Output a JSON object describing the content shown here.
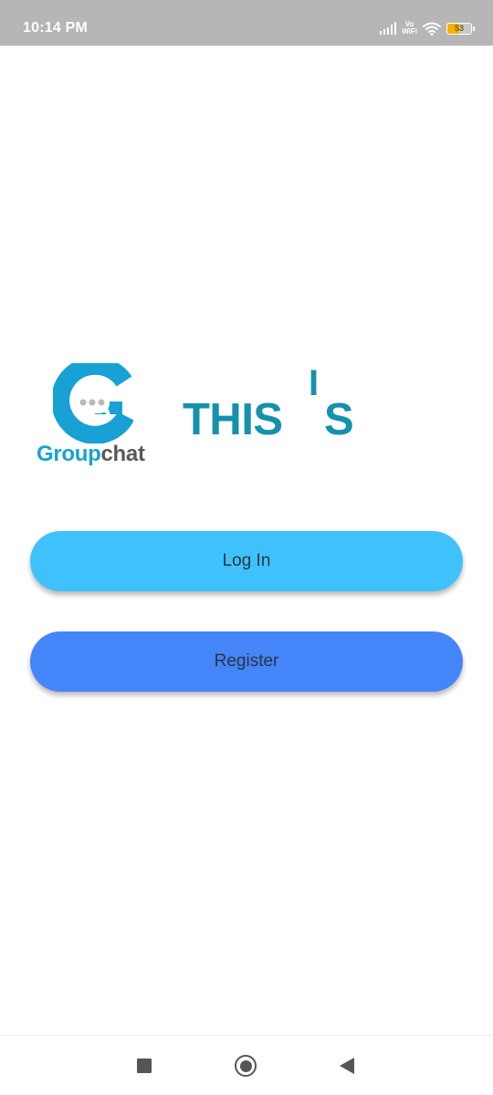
{
  "status_bar": {
    "time": "10:14 PM",
    "vowifi_top": "Vo",
    "vowifi_bottom": "WiFi",
    "battery_level": "53",
    "icons": [
      "signal-icon",
      "vowifi-icon",
      "wifi-icon",
      "battery-icon"
    ]
  },
  "hero": {
    "logo_icon": "groupchat-logo-icon",
    "logo_text_group": "Group",
    "logo_text_chat": "chat",
    "tagline_word": "THIS",
    "tagline_i": "I",
    "tagline_s": "S"
  },
  "buttons": {
    "login_label": "Log In",
    "register_label": "Register"
  },
  "nav_bar": {
    "icons": [
      "recent-apps-icon",
      "home-icon",
      "back-icon"
    ]
  },
  "colors": {
    "brand_blue": "#17a1d4",
    "tagline_teal": "#1592ab",
    "login_button": "#3fc2fb",
    "register_button": "#4585fa",
    "status_bar": "#b6b6b6"
  }
}
